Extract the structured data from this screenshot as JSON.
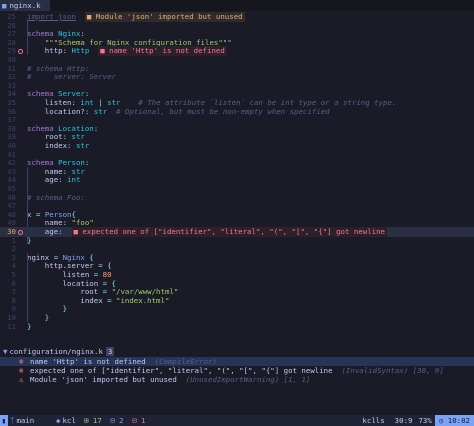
{
  "tab": {
    "icon": "file-icon",
    "name": "nginx.k"
  },
  "lines": [
    {
      "n": "25",
      "guide": false,
      "sign": "",
      "segs": [
        [
          "dim",
          "import json"
        ]
      ],
      "vtext": {
        "kind": "warn",
        "text": "Module 'json' imported but unused"
      }
    },
    {
      "n": "26",
      "segs": []
    },
    {
      "n": "27",
      "segs": [
        [
          "vt",
          "schema "
        ],
        [
          "ty",
          "Nginx"
        ],
        [
          "op",
          ":"
        ]
      ]
    },
    {
      "n": "28",
      "segs": [
        [
          "id",
          "    "
        ],
        [
          "st",
          "\"\"\"Schema for Nginx configuration files\"\"\""
        ]
      ]
    },
    {
      "n": "29",
      "sign": "err",
      "segs": [
        [
          "id",
          "    http"
        ],
        [
          "op",
          ": "
        ],
        [
          "ty",
          "Http"
        ]
      ],
      "vtext": {
        "kind": "err",
        "text": "name 'Http' is not defined"
      }
    },
    {
      "n": "30",
      "segs": []
    },
    {
      "n": "31",
      "segs": [
        [
          "cm",
          "# schema Http:"
        ]
      ]
    },
    {
      "n": "32",
      "segs": [
        [
          "cm",
          "#     server: Server"
        ]
      ]
    },
    {
      "n": "33",
      "segs": []
    },
    {
      "n": "34",
      "segs": [
        [
          "vt",
          "schema "
        ],
        [
          "ty",
          "Server"
        ],
        [
          "op",
          ":"
        ]
      ]
    },
    {
      "n": "35",
      "segs": [
        [
          "id",
          "    listen"
        ],
        [
          "op",
          ": "
        ],
        [
          "ty",
          "int"
        ],
        [
          "op",
          " | "
        ],
        [
          "ty",
          "str"
        ],
        [
          "id",
          "    "
        ],
        [
          "cm",
          "# The attribute `listen` can be int type or a string type."
        ]
      ]
    },
    {
      "n": "36",
      "segs": [
        [
          "id",
          "    location?"
        ],
        [
          "op",
          ": "
        ],
        [
          "ty",
          "str"
        ],
        [
          "id",
          "  "
        ],
        [
          "cm",
          "# Optional, but must be non-empty when specified"
        ]
      ]
    },
    {
      "n": "37",
      "segs": []
    },
    {
      "n": "38",
      "segs": [
        [
          "vt",
          "schema "
        ],
        [
          "ty",
          "Location"
        ],
        [
          "op",
          ":"
        ]
      ]
    },
    {
      "n": "39",
      "segs": [
        [
          "id",
          "    root"
        ],
        [
          "op",
          ": "
        ],
        [
          "ty",
          "str"
        ]
      ]
    },
    {
      "n": "40",
      "segs": [
        [
          "id",
          "    index"
        ],
        [
          "op",
          ": "
        ],
        [
          "ty",
          "str"
        ]
      ]
    },
    {
      "n": "41",
      "segs": []
    },
    {
      "n": "42",
      "segs": [
        [
          "vt",
          "schema "
        ],
        [
          "ty",
          "Person"
        ],
        [
          "op",
          ":"
        ]
      ]
    },
    {
      "n": "43",
      "segs": [
        [
          "id",
          "    name"
        ],
        [
          "op",
          ": "
        ],
        [
          "ty",
          "str"
        ]
      ]
    },
    {
      "n": "44",
      "segs": [
        [
          "id",
          "    age"
        ],
        [
          "op",
          ": "
        ],
        [
          "ty",
          "int"
        ]
      ]
    },
    {
      "n": "45",
      "segs": []
    },
    {
      "n": "46",
      "segs": [
        [
          "cm",
          "# schema Foo:"
        ]
      ]
    },
    {
      "n": "47",
      "segs": []
    },
    {
      "n": "48",
      "segs": [
        [
          "id",
          "x "
        ],
        [
          "op",
          "= "
        ],
        [
          "fn",
          "Person"
        ],
        [
          "op",
          "{"
        ]
      ]
    },
    {
      "n": "49",
      "segs": [
        [
          "id",
          "    name"
        ],
        [
          "op",
          ": "
        ],
        [
          "st",
          "\"foo\""
        ]
      ]
    },
    {
      "n": "30",
      "cursor": true,
      "sign": "err",
      "segs": [
        [
          "id",
          "    age"
        ],
        [
          "op",
          ":"
        ]
      ],
      "vtext": {
        "kind": "err",
        "text": "expected one of [\"identifier\", \"literal\", \"(\", \"[\", \"{\"] got newline"
      }
    },
    {
      "n": "1",
      "segs": [
        [
          "op",
          "}"
        ]
      ]
    },
    {
      "n": "2",
      "segs": []
    },
    {
      "n": "3",
      "segs": [
        [
          "id",
          "nginx "
        ],
        [
          "op",
          "= "
        ],
        [
          "fn",
          "Nginx"
        ],
        [
          "op",
          " {"
        ]
      ]
    },
    {
      "n": "4",
      "segs": [
        [
          "id",
          "    http.server "
        ],
        [
          "op",
          "= {"
        ]
      ]
    },
    {
      "n": "5",
      "segs": [
        [
          "id",
          "        listen "
        ],
        [
          "op",
          "= "
        ],
        [
          "nu",
          "80"
        ]
      ]
    },
    {
      "n": "6",
      "segs": [
        [
          "id",
          "        location "
        ],
        [
          "op",
          "= {"
        ]
      ]
    },
    {
      "n": "7",
      "segs": [
        [
          "id",
          "            root "
        ],
        [
          "op",
          "= "
        ],
        [
          "st",
          "\"/var/www/html\""
        ]
      ]
    },
    {
      "n": "8",
      "segs": [
        [
          "id",
          "            index "
        ],
        [
          "op",
          "= "
        ],
        [
          "st",
          "\"index.html\""
        ]
      ]
    },
    {
      "n": "9",
      "segs": [
        [
          "op",
          "        }"
        ]
      ]
    },
    {
      "n": "10",
      "segs": [
        [
          "op",
          "    }"
        ]
      ]
    },
    {
      "n": "11",
      "segs": [
        [
          "op",
          "}"
        ]
      ]
    }
  ],
  "quickfix": {
    "file": "configuration/nginx.k",
    "count": "3",
    "items": [
      {
        "kind": "err",
        "text": "name 'Http' is not defined",
        "source": "(CompileError)",
        "loc": "",
        "selected": true
      },
      {
        "kind": "err",
        "text": "expected one of [\"identifier\", \"literal\", \"(\", \"[\", \"{\"] got newline",
        "source": "(InvalidSyntax)",
        "loc": "[30, 9]",
        "selected": false
      },
      {
        "kind": "warn",
        "text": "Module 'json' imported but unused",
        "source": "(UnusedImportWarning)",
        "loc": "[1, 1]",
        "selected": false
      }
    ]
  },
  "status": {
    "branch": "main",
    "lang": "kcl",
    "counts": [
      "17",
      "2",
      "1"
    ],
    "lsp": "kclls",
    "position": "30:9",
    "percent": "73%",
    "clock": "10:02"
  },
  "colors": {
    "accent": "#7aa2f7",
    "error": "#f7768e",
    "warning": "#e0af68",
    "background": "#1a1b26"
  }
}
